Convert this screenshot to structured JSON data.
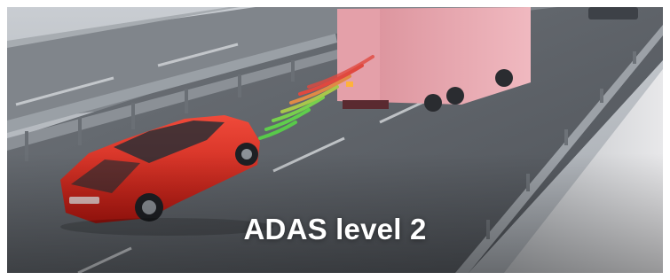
{
  "banner": {
    "title": "ADAS level 2",
    "image": {
      "scene_icons": [
        "red-sedan-icon",
        "semi-truck-icon",
        "guardrail-icon",
        "sensor-wave-icon"
      ],
      "colors": {
        "car": "#d9261c",
        "truck_trailer": "#e6a3ab",
        "road": "#5d6167",
        "sensor_green": "#58c94a",
        "sensor_red": "#e0483f"
      }
    }
  }
}
